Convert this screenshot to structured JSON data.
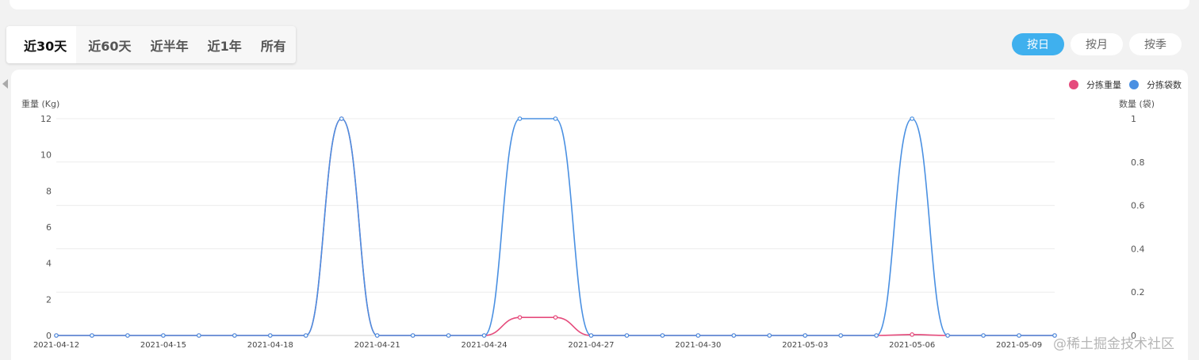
{
  "range_tabs": [
    "近30天",
    "近60天",
    "近半年",
    "近1年",
    "所有"
  ],
  "range_active": 0,
  "granularity": [
    "按日",
    "按月",
    "按季"
  ],
  "granularity_active": 0,
  "watermark": "@稀土掘金技术社区",
  "colors": {
    "weight": "#e54b7c",
    "bags": "#4a90e2",
    "accent": "#3fb0ee"
  },
  "chart_data": {
    "type": "line",
    "smooth": true,
    "x": [
      "2021-04-12",
      "2021-04-13",
      "2021-04-14",
      "2021-04-15",
      "2021-04-16",
      "2021-04-17",
      "2021-04-18",
      "2021-04-19",
      "2021-04-20",
      "2021-04-21",
      "2021-04-22",
      "2021-04-23",
      "2021-04-24",
      "2021-04-25",
      "2021-04-26",
      "2021-04-27",
      "2021-04-28",
      "2021-04-29",
      "2021-04-30",
      "2021-05-01",
      "2021-05-02",
      "2021-05-03",
      "2021-05-04",
      "2021-05-05",
      "2021-05-06",
      "2021-05-07",
      "2021-05-08",
      "2021-05-09",
      "2021-05-10"
    ],
    "x_tick_labels": [
      "2021-04-12",
      "2021-04-15",
      "2021-04-18",
      "2021-04-21",
      "2021-04-24",
      "2021-04-27",
      "2021-04-30",
      "2021-05-03",
      "2021-05-06",
      "2021-05-09"
    ],
    "series": [
      {
        "name": "分拣重量",
        "axis": "left",
        "color": "#e54b7c",
        "values": [
          0,
          0,
          0,
          0,
          0,
          0,
          0,
          0,
          12,
          0,
          0,
          0,
          0,
          1,
          1,
          0,
          0,
          0,
          0,
          0,
          0,
          0,
          0,
          0,
          0.05,
          0,
          0,
          0,
          0
        ]
      },
      {
        "name": "分拣袋数",
        "axis": "right",
        "color": "#4a90e2",
        "values": [
          0,
          0,
          0,
          0,
          0,
          0,
          0,
          0,
          1,
          0,
          0,
          0,
          0,
          1,
          1,
          0,
          0,
          0,
          0,
          0,
          0,
          0,
          0,
          0,
          1,
          0,
          0,
          0,
          0
        ]
      }
    ],
    "y_left": {
      "label": "重量 (Kg)",
      "min": 0,
      "max": 12,
      "ticks": [
        0,
        2,
        4,
        6,
        8,
        10,
        12
      ]
    },
    "y_right": {
      "label": "数量 (袋)",
      "min": 0,
      "max": 1,
      "ticks": [
        "0",
        "0.2",
        "0.4",
        "0.6",
        "0.8",
        "1"
      ]
    },
    "legend_position": "top-right",
    "grid": true
  }
}
